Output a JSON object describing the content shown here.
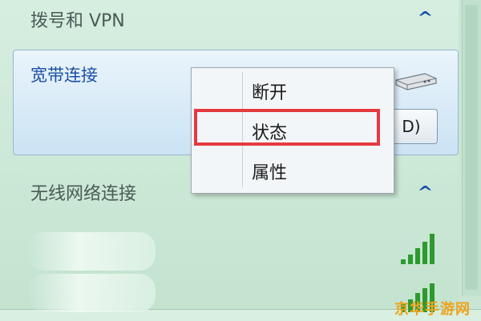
{
  "sections": {
    "dialup_vpn": {
      "title": "拨号和 VPN",
      "caret": "^"
    },
    "wireless": {
      "title": "无线网络连接",
      "caret": "^"
    }
  },
  "connection": {
    "name": "宽带连接",
    "button_label": "D)"
  },
  "context_menu": {
    "items": [
      "断开",
      "状态",
      "属性"
    ],
    "highlighted_index": 1
  },
  "watermark": "京华手游网",
  "colors": {
    "highlight": "#e63a40",
    "link_blue": "#1b4fa5",
    "signal_green": "#2e9a2e"
  },
  "icons": {
    "modem": "modem-icon",
    "signal": "wifi-signal-icon"
  }
}
